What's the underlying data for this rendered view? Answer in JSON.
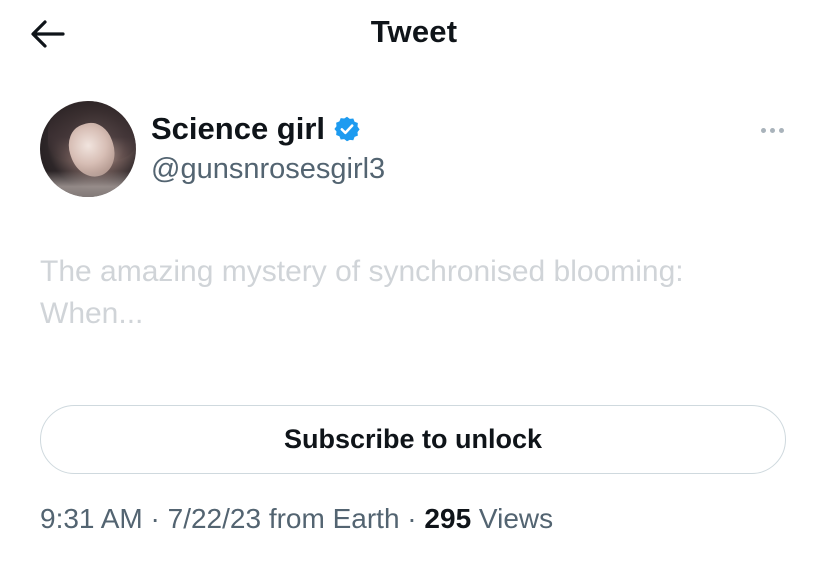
{
  "header": {
    "title": "Tweet",
    "back_icon": "arrow-left-icon"
  },
  "author": {
    "display_name": "Science girl",
    "handle": "@gunsnrosesgirl3",
    "verified": true,
    "verified_icon": "verified-badge-icon",
    "more_icon": "more-options-icon"
  },
  "tweet": {
    "text_line1": "The amazing mystery of synchronised blooming:",
    "text_line2": "When..."
  },
  "subscribe": {
    "label": "Subscribe to unlock"
  },
  "meta": {
    "time": "9:31 AM",
    "separator": " · ",
    "date": "7/22/23",
    "source": "from Earth",
    "views_count": "295",
    "views_label": "Views"
  },
  "colors": {
    "text": "#0f1419",
    "secondary": "#536471",
    "muted_text": "#d0d4d8",
    "verified_blue": "#1d9bf0",
    "border": "#cfd9de"
  }
}
